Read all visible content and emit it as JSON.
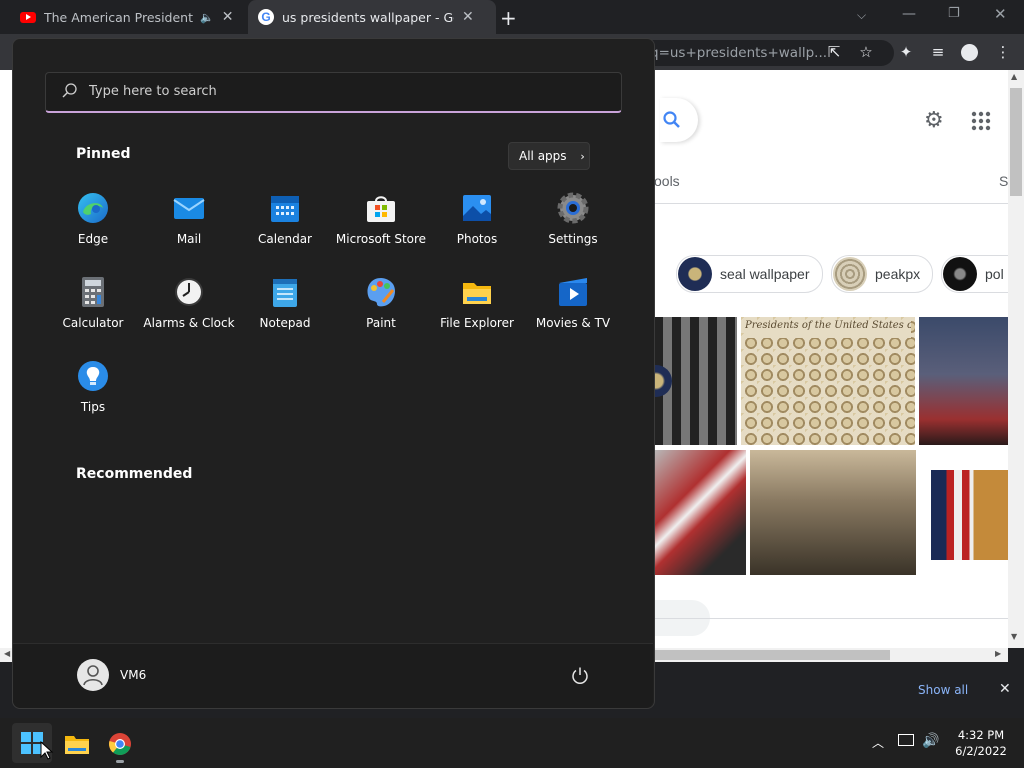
{
  "browser": {
    "tabs": [
      {
        "title": "The American Presidential El",
        "favicon": "youtube-icon",
        "muted_icon": "speaker-icon"
      },
      {
        "title": "us presidents wallpaper - Google",
        "favicon": "google-icon"
      }
    ],
    "new_tab_symbol": "+",
    "address": "q=us+presidents+wallp..."
  },
  "google": {
    "tools_label": "ools",
    "cut_tab_label": "S",
    "chips": [
      {
        "label": "seal wallpaper"
      },
      {
        "label": "peakpx"
      },
      {
        "label": "pol"
      }
    ],
    "image_caption": "Presidents of the United States of A"
  },
  "download_bar": {
    "show_all": "Show all"
  },
  "start_menu": {
    "search_placeholder": "Type here to search",
    "pinned_label": "Pinned",
    "all_apps_label": "All apps",
    "apps": [
      {
        "label": "Edge",
        "icon": "edge-icon"
      },
      {
        "label": "Mail",
        "icon": "mail-icon"
      },
      {
        "label": "Calendar",
        "icon": "calendar-icon"
      },
      {
        "label": "Microsoft Store",
        "icon": "store-icon"
      },
      {
        "label": "Photos",
        "icon": "photos-icon"
      },
      {
        "label": "Settings",
        "icon": "settings-icon"
      },
      {
        "label": "Calculator",
        "icon": "calculator-icon"
      },
      {
        "label": "Alarms & Clock",
        "icon": "clock-icon"
      },
      {
        "label": "Notepad",
        "icon": "notepad-icon"
      },
      {
        "label": "Paint",
        "icon": "paint-icon"
      },
      {
        "label": "File Explorer",
        "icon": "folder-icon"
      },
      {
        "label": "Movies & TV",
        "icon": "movies-icon"
      },
      {
        "label": "Tips",
        "icon": "tips-icon"
      }
    ],
    "recommended_label": "Recommended",
    "user_name": "VM6"
  },
  "taskbar": {
    "time": "4:32 PM",
    "date": "6/2/2022"
  },
  "colors": {
    "start_bg": "#202020",
    "accent": "#c9a3d9",
    "link_blue": "#8ab4f8"
  }
}
